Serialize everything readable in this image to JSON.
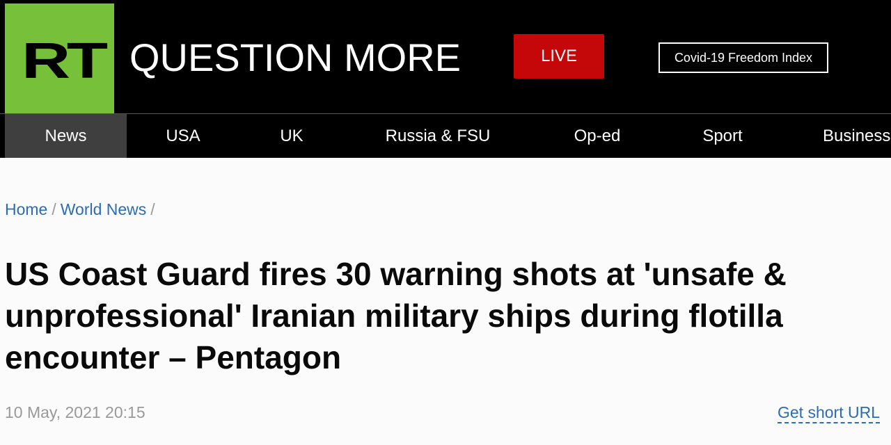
{
  "header": {
    "logo_text": "RT",
    "tagline": "QUESTION MORE",
    "live_label": "LIVE",
    "covid_label": "Covid-19 Freedom Index",
    "logo_color": "#77c03a",
    "live_color": "#c4080a"
  },
  "nav": {
    "items": [
      {
        "label": "News",
        "active": true
      },
      {
        "label": "USA",
        "active": false
      },
      {
        "label": "UK",
        "active": false
      },
      {
        "label": "Russia & FSU",
        "active": false
      },
      {
        "label": "Op-ed",
        "active": false
      },
      {
        "label": "Sport",
        "active": false
      },
      {
        "label": "Business",
        "active": false
      }
    ]
  },
  "breadcrumb": {
    "home": "Home",
    "sep1": "/",
    "section": "World News",
    "sep2": "/"
  },
  "article": {
    "headline": "US Coast Guard fires 30 warning shots at 'unsafe & unprofessional' Iranian military ships during flotilla encounter – Pentagon",
    "date": "10 May, 2021 20:15",
    "short_url_label": "Get short URL"
  }
}
